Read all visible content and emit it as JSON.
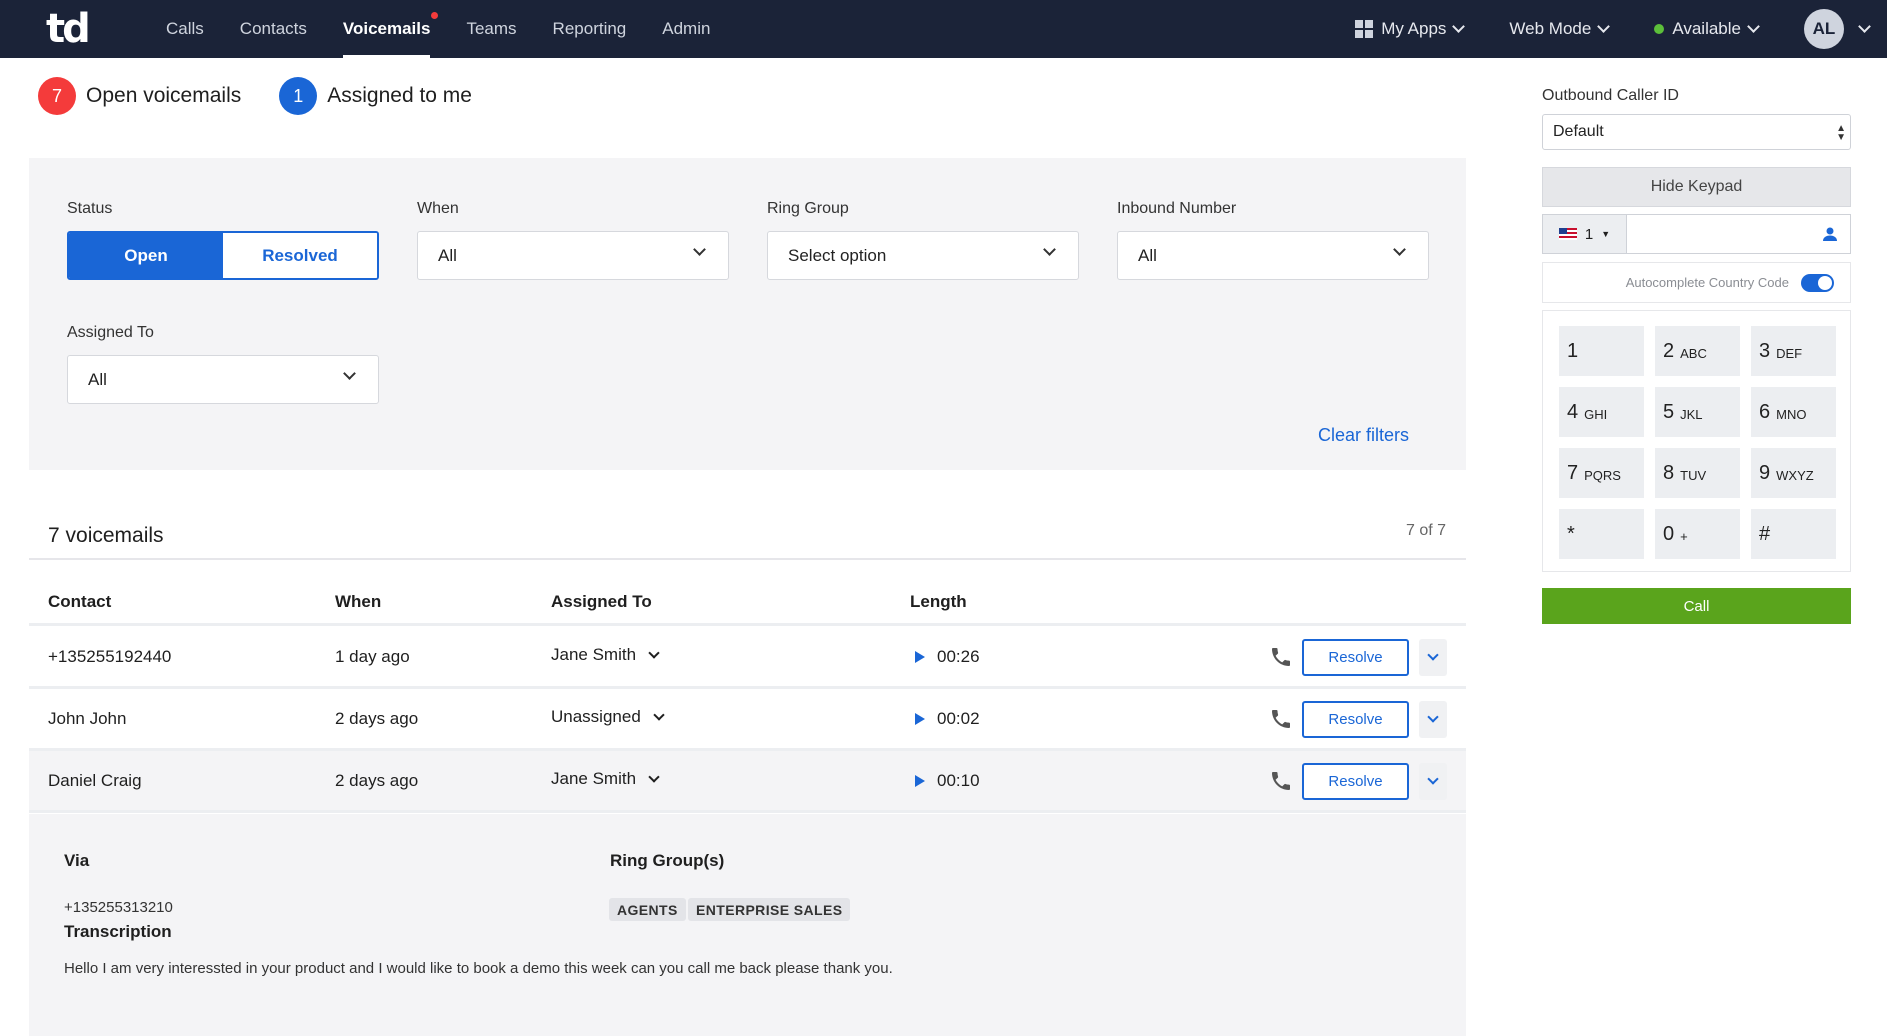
{
  "header": {
    "logo": "td",
    "nav": [
      {
        "label": "Calls"
      },
      {
        "label": "Contacts"
      },
      {
        "label": "Voicemails"
      },
      {
        "label": "Teams"
      },
      {
        "label": "Reporting"
      },
      {
        "label": "Admin"
      }
    ],
    "my_apps": "My Apps",
    "mode": "Web Mode",
    "status": "Available",
    "avatar": "AL"
  },
  "summary": {
    "open_count": "7",
    "open_label": "Open voicemails",
    "assigned_count": "1",
    "assigned_label": "Assigned to me"
  },
  "filters": {
    "status_label": "Status",
    "status_open": "Open",
    "status_resolved": "Resolved",
    "when_label": "When",
    "when_value": "All",
    "ring_group_label": "Ring Group",
    "ring_group_value": "Select option",
    "inbound_label": "Inbound Number",
    "inbound_value": "All",
    "assigned_label": "Assigned To",
    "assigned_value": "All",
    "clear": "Clear filters"
  },
  "table": {
    "title": "7 voicemails",
    "count": "7 of 7",
    "columns": [
      "Contact",
      "When",
      "Assigned To",
      "Length"
    ],
    "resolve_label": "Resolve",
    "rows": [
      {
        "contact": "+135255192440",
        "when": "1 day ago",
        "assigned": "Jane Smith",
        "length": "00:26"
      },
      {
        "contact": "John John",
        "when": "2 days ago",
        "assigned": "Unassigned",
        "length": "00:02"
      },
      {
        "contact": "Daniel Craig",
        "when": "2 days ago",
        "assigned": "Jane Smith",
        "length": "00:10"
      }
    ]
  },
  "details": {
    "via_label": "Via",
    "via_value": "+135255313210",
    "ring_groups_label": "Ring Group(s)",
    "ring_groups": [
      "AGENTS",
      "ENTERPRISE SALES"
    ],
    "transcription_label": "Transcription",
    "transcription": "Hello I am very interessted in your product and I would like to book a demo this week can you call me back please thank you."
  },
  "dialer": {
    "caller_id_label": "Outbound Caller ID",
    "caller_id_value": "Default",
    "hide_keypad": "Hide Keypad",
    "country_code": "1",
    "autocomplete_label": "Autocomplete Country Code",
    "keys": [
      {
        "digit": "1",
        "letters": ""
      },
      {
        "digit": "2",
        "letters": "ABC"
      },
      {
        "digit": "3",
        "letters": "DEF"
      },
      {
        "digit": "4",
        "letters": "GHI"
      },
      {
        "digit": "5",
        "letters": "JKL"
      },
      {
        "digit": "6",
        "letters": "MNO"
      },
      {
        "digit": "7",
        "letters": "PQRS"
      },
      {
        "digit": "8",
        "letters": "TUV"
      },
      {
        "digit": "9",
        "letters": "WXYZ"
      },
      {
        "digit": "*",
        "letters": ""
      },
      {
        "digit": "0",
        "letters": "+"
      },
      {
        "digit": "#",
        "letters": ""
      }
    ],
    "call": "Call"
  },
  "colors": {
    "nav_bg": "#1b2338",
    "accent": "#1a66d6",
    "badge_red": "#f43b3b",
    "call_green": "#5aa41c",
    "available_green": "#5cbf3a"
  }
}
